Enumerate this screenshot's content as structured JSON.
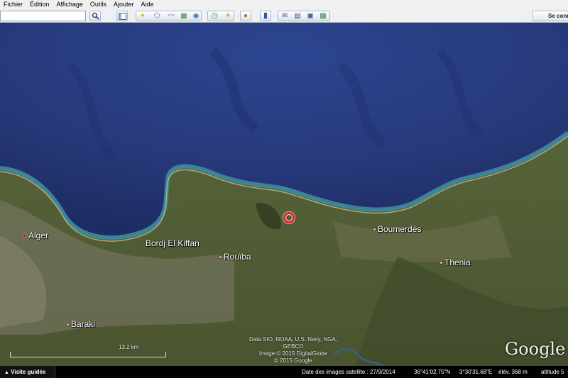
{
  "menu": [
    "Fichier",
    "Édition",
    "Affichage",
    "Outils",
    "Ajouter",
    "Aide"
  ],
  "search": {
    "value": ""
  },
  "toolbar": {
    "signin_label": "Se connecter"
  },
  "map": {
    "places": [
      {
        "label": "Alger",
        "capital": true
      },
      {
        "label": "Bordj El Kiffan",
        "capital": false
      },
      {
        "label": "Rouïba",
        "capital": false
      },
      {
        "label": "Boumerdès",
        "capital": false
      },
      {
        "label": "Thenia",
        "capital": false
      },
      {
        "label": "Baraki",
        "capital": false
      }
    ],
    "attribution": [
      "Data SIO, NOAA, U.S. Navy, NGA, GEBCO",
      "Image © 2015 DigitalGlobe",
      "© 2015 Google"
    ],
    "scale_label": "13.2 km",
    "logo": "Google earth",
    "colors": {
      "sea": "#2a3f86",
      "coast": "#3f8fa0",
      "land": "#56603a",
      "marker": "#e0222a"
    }
  },
  "status": {
    "tour_label": "Visite guidée",
    "imagery_date": "Date des images satellite : 27/9/2014",
    "lat": "36°41'02.75\"N",
    "lon": "3°30'31.68\"E",
    "elev": "élév.  368 m",
    "alt": "altitude  5"
  }
}
